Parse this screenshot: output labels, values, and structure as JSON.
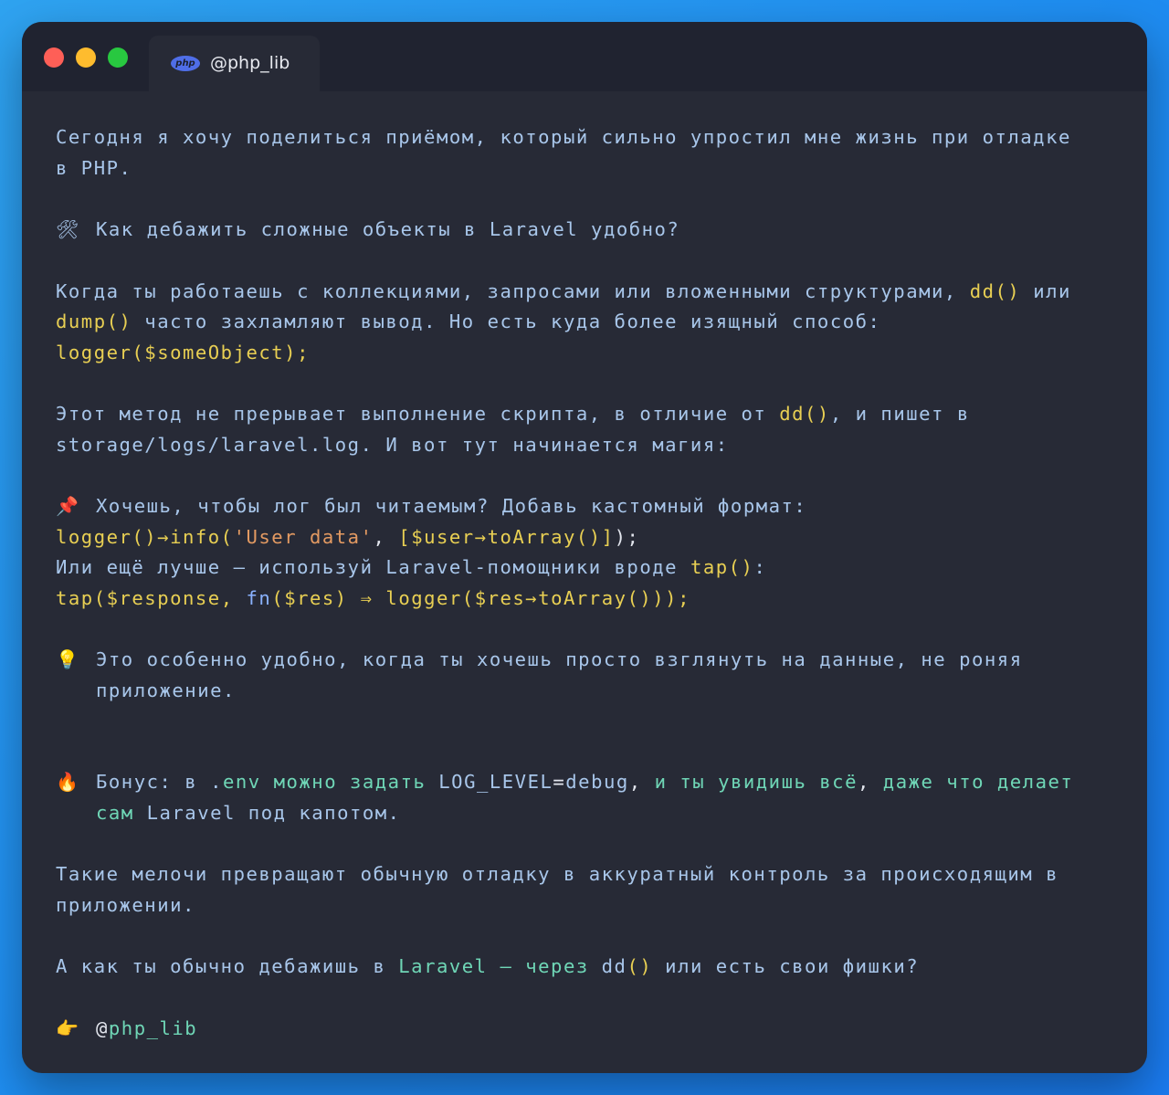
{
  "tab": {
    "icon_name": "php-icon",
    "icon_text": "php",
    "title": "@php_lib"
  },
  "post": {
    "intro_l1": "Сегодня я хочу поделиться приёмом, который сильно упростил мне жизнь при отладке",
    "intro_l2": "в PHP.",
    "h1_emoji": "🛠",
    "h1_text": "Как дебажить сложные объекты в Laravel удобно?",
    "p2_l1_text": "Когда ты работаешь с коллекциями, запросами или вложенными структурами, ",
    "p2_l1_code": "dd()",
    "p2_l1_tail": " или",
    "p2_l2_code": "dump()",
    "p2_l2_text": " часто захламляют вывод. Но есть куда более изящный способ:",
    "p2_l3_code": "logger($someObject);",
    "p3_l1_text": "Этот метод не прерывает выполнение скрипта, в отличие от ",
    "p3_l1_code": "dd()",
    "p3_l1_tail": ", и пишет в",
    "p3_l2_text": "storage/logs/laravel.log. И вот тут начинается магия:",
    "h2_emoji": "📌",
    "h2_text": "Хочешь, чтобы лог был читаемым? Добавь кастомный формат:",
    "code1_a": "logger()→info(",
    "code1_str": "'User data'",
    "code1_b": ", ",
    "code1_c": "[$user→toArray()]",
    "code1_d": ");",
    "p4_text": "Или ещё лучше — используй Laravel-помощники вроде ",
    "p4_code": "tap()",
    "p4_tail": ":",
    "code2_a": "tap(",
    "code2_b": "$response, ",
    "code2_fn": "fn",
    "code2_c": "($res)",
    "code2_d": " ⇒ logger($res→toArray()));",
    "tip_emoji": "💡",
    "tip_l1": "Это особенно удобно, когда ты хочешь просто взглянуть на данные, не роняя",
    "tip_l2": "приложение.",
    "bonus_emoji": "🔥",
    "bonus_a": "Бонус: в .",
    "bonus_b": "env можно задать ",
    "bonus_c": "LOG_LEVEL",
    "bonus_d": "=",
    "bonus_e": "debug",
    "bonus_f": ", ",
    "bonus_g": "и ты увидишь всё",
    "bonus_h": ", ",
    "bonus_i": "даже что делает",
    "bonus_l2_a": "сам",
    "bonus_l2_b": " Laravel под капотом.",
    "p5_l1": "Такие мелочи превращают обычную отладку в аккуратный контроль за происходящим в",
    "p5_l2": "приложении.",
    "q_a": "А как ты обычно дебажишь в ",
    "q_b": "Laravel — через",
    "q_c": " dd",
    "q_d": "()",
    "q_e": " или есть свои фишки?",
    "sig_emoji": "👉",
    "sig_at": "@",
    "sig_name": "php_lib"
  }
}
